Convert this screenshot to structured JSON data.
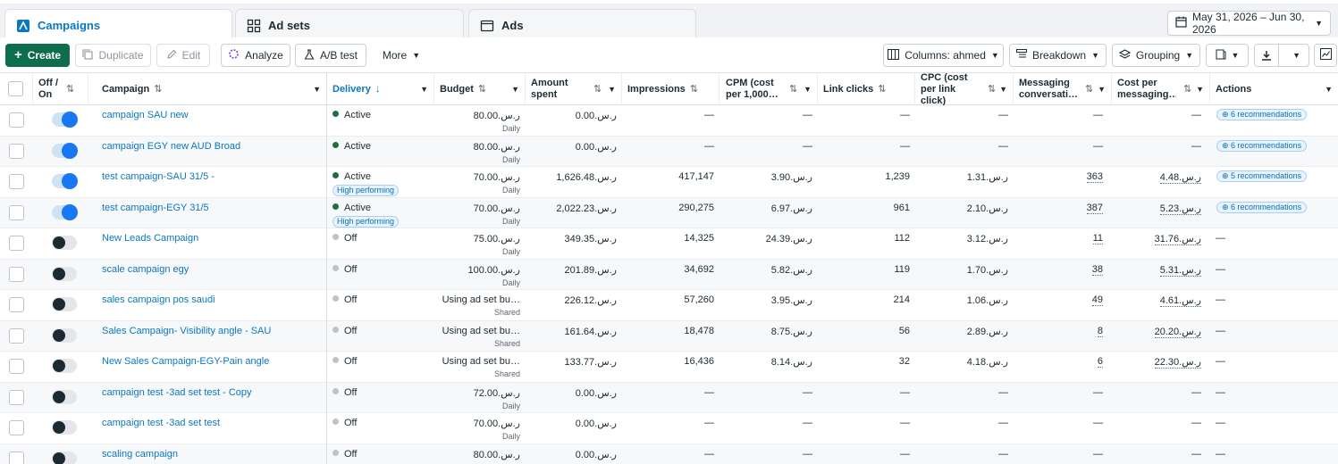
{
  "tabs": [
    {
      "label": "Campaigns",
      "icon": "campaigns-icon"
    },
    {
      "label": "Ad sets",
      "icon": "adsets-icon"
    },
    {
      "label": "Ads",
      "icon": "ads-icon"
    }
  ],
  "date_range": "May 31, 2026 – Jun 30, 2026",
  "toolbar": {
    "create": "Create",
    "duplicate": "Duplicate",
    "edit": "Edit",
    "analyze": "Analyze",
    "ab_test": "A/B test",
    "more": "More",
    "columns": "Columns: ahmed",
    "breakdown": "Breakdown",
    "grouping": "Grouping"
  },
  "headers": {
    "off_on": "Off / On",
    "campaign": "Campaign",
    "delivery": "Delivery",
    "budget": "Budget",
    "amount_spent": "Amount spent",
    "impressions": "Impressions",
    "cpm": "CPM (cost per 1,000…",
    "link_clicks": "Link clicks",
    "cpc": "CPC (cost per link click)",
    "messaging": "Messaging conversati…",
    "cost_messaging": "Cost per messaging…",
    "actions": "Actions"
  },
  "rows": [
    {
      "on": true,
      "name": "campaign SAU new",
      "delivery": "Active",
      "status": "active",
      "badge": "",
      "budget": "ر.س.80.00",
      "budget_type": "Daily",
      "spent": "ر.س.0.00",
      "impressions": "—",
      "cpm": "—",
      "clicks": "—",
      "cpc": "—",
      "msg": "—",
      "cost_msg": "—",
      "action": "6 recommendations"
    },
    {
      "on": true,
      "name": "campaign EGY new AUD Broad",
      "delivery": "Active",
      "status": "active",
      "badge": "",
      "budget": "ر.س.80.00",
      "budget_type": "Daily",
      "spent": "ر.س.0.00",
      "impressions": "—",
      "cpm": "—",
      "clicks": "—",
      "cpc": "—",
      "msg": "—",
      "cost_msg": "—",
      "action": "6 recommendations"
    },
    {
      "on": true,
      "name": "test campaign-SAU 31/5 -",
      "delivery": "Active",
      "status": "active",
      "badge": "High performing",
      "budget": "ر.س.70.00",
      "budget_type": "Daily",
      "spent": "ر.س.1,626.48",
      "impressions": "417,147",
      "cpm": "ر.س.3.90",
      "clicks": "1,239",
      "cpc": "ر.س.1.31",
      "msg": "363",
      "cost_msg": "ر.س.4.48",
      "action": "5 recommendations"
    },
    {
      "on": true,
      "name": "test campaign-EGY 31/5",
      "delivery": "Active",
      "status": "active",
      "badge": "High performing",
      "budget": "ر.س.70.00",
      "budget_type": "Daily",
      "spent": "ر.س.2,022.23",
      "impressions": "290,275",
      "cpm": "ر.س.6.97",
      "clicks": "961",
      "cpc": "ر.س.2.10",
      "msg": "387",
      "cost_msg": "ر.س.5.23",
      "action": "6 recommendations"
    },
    {
      "on": false,
      "name": "New Leads Campaign",
      "delivery": "Off",
      "status": "off",
      "badge": "",
      "budget": "ر.س.75.00",
      "budget_type": "Daily",
      "spent": "ر.س.349.35",
      "impressions": "14,325",
      "cpm": "ر.س.24.39",
      "clicks": "112",
      "cpc": "ر.س.3.12",
      "msg": "11",
      "cost_msg": "ر.س.31.76",
      "action": "—"
    },
    {
      "on": false,
      "name": "scale campaign egy",
      "delivery": "Off",
      "status": "off",
      "badge": "",
      "budget": "ر.س.100.00",
      "budget_type": "Daily",
      "spent": "ر.س.201.89",
      "impressions": "34,692",
      "cpm": "ر.س.5.82",
      "clicks": "119",
      "cpc": "ر.س.1.70",
      "msg": "38",
      "cost_msg": "ر.س.5.31",
      "action": "—"
    },
    {
      "on": false,
      "name": "sales campaign pos saudi",
      "delivery": "Off",
      "status": "off",
      "badge": "",
      "budget": "Using ad set bu…",
      "budget_type": "Shared",
      "spent": "ر.س.226.12",
      "impressions": "57,260",
      "cpm": "ر.س.3.95",
      "clicks": "214",
      "cpc": "ر.س.1.06",
      "msg": "49",
      "cost_msg": "ر.س.4.61",
      "action": "—"
    },
    {
      "on": false,
      "name": "Sales Campaign- Visibility angle - SAU",
      "delivery": "Off",
      "status": "off",
      "badge": "",
      "budget": "Using ad set bu…",
      "budget_type": "Shared",
      "spent": "ر.س.161.64",
      "impressions": "18,478",
      "cpm": "ر.س.8.75",
      "clicks": "56",
      "cpc": "ر.س.2.89",
      "msg": "8",
      "cost_msg": "ر.س.20.20",
      "action": "—"
    },
    {
      "on": false,
      "name": "New Sales Campaign-EGY-Pain angle",
      "delivery": "Off",
      "status": "off",
      "badge": "",
      "budget": "Using ad set bu…",
      "budget_type": "Shared",
      "spent": "ر.س.133.77",
      "impressions": "16,436",
      "cpm": "ر.س.8.14",
      "clicks": "32",
      "cpc": "ر.س.4.18",
      "msg": "6",
      "cost_msg": "ر.س.22.30",
      "action": "—"
    },
    {
      "on": false,
      "name": "campaign test -3ad set test - Copy",
      "delivery": "Off",
      "status": "off",
      "badge": "",
      "budget": "ر.س.72.00",
      "budget_type": "Daily",
      "spent": "ر.س.0.00",
      "impressions": "—",
      "cpm": "—",
      "clicks": "—",
      "cpc": "—",
      "msg": "—",
      "cost_msg": "—",
      "action": "—"
    },
    {
      "on": false,
      "name": "campaign test -3ad set test",
      "delivery": "Off",
      "status": "off",
      "badge": "",
      "budget": "ر.س.70.00",
      "budget_type": "Daily",
      "spent": "ر.س.0.00",
      "impressions": "—",
      "cpm": "—",
      "clicks": "—",
      "cpc": "—",
      "msg": "—",
      "cost_msg": "—",
      "action": "—"
    },
    {
      "on": false,
      "name": "scaling campaign",
      "delivery": "Off",
      "status": "off",
      "badge": "",
      "budget": "ر.س.80.00",
      "budget_type": "Daily",
      "spent": "ر.س.0.00",
      "impressions": "—",
      "cpm": "—",
      "clicks": "—",
      "cpc": "—",
      "msg": "—",
      "cost_msg": "—",
      "action": "—"
    }
  ]
}
